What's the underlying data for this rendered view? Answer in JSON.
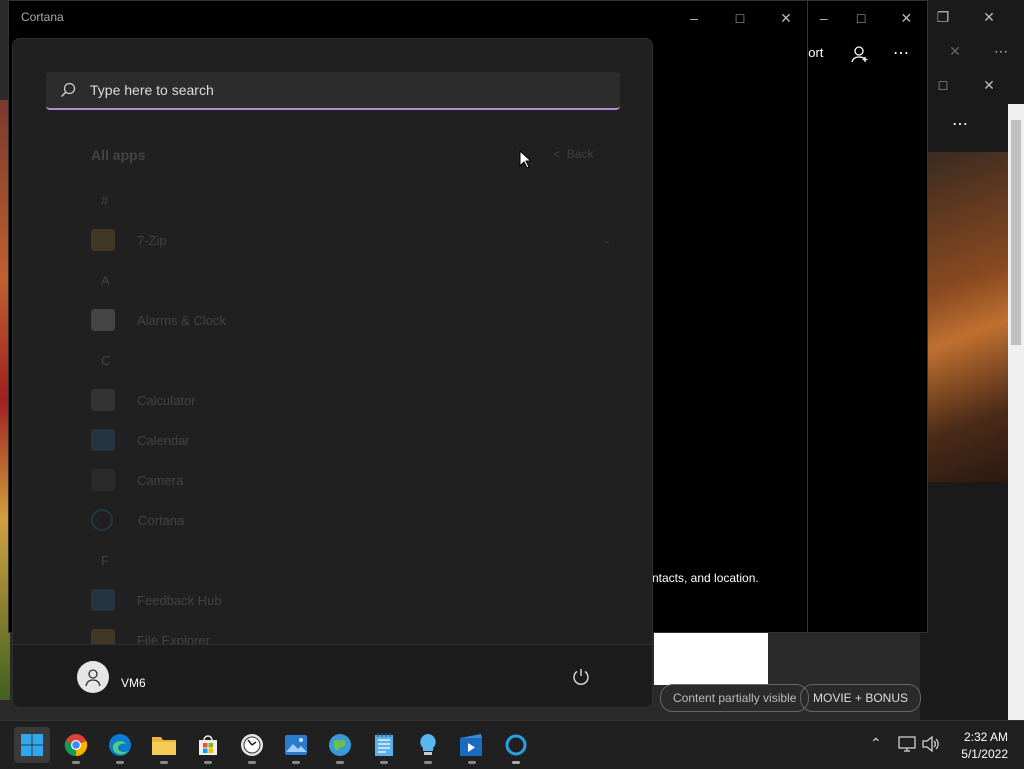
{
  "cortana_window": {
    "title": "Cortana"
  },
  "behind_window": {
    "menu_fragment": "port",
    "text_fragment": "ntacts, and location."
  },
  "media_app": {
    "chip_left": "Content partially visible",
    "chip_right": "MOVIE + BONUS"
  },
  "start_menu": {
    "search_placeholder": "Type here to search",
    "all_apps_label": "All apps",
    "back_label": "Back",
    "groups": [
      {
        "letter": "#",
        "apps": [
          {
            "name": "7-Zip",
            "icon": "folder-icon",
            "color": "#d4a53a"
          }
        ]
      },
      {
        "letter": "A",
        "apps": [
          {
            "name": "Alarms & Clock",
            "icon": "clock-icon",
            "color": "#e8e8e8"
          }
        ]
      },
      {
        "letter": "C",
        "apps": [
          {
            "name": "Calculator",
            "icon": "calculator-icon",
            "color": "#8a8a8a"
          },
          {
            "name": "Calendar",
            "icon": "calendar-icon",
            "color": "#3a8fd8"
          },
          {
            "name": "Camera",
            "icon": "camera-icon",
            "color": "#5a5a5a"
          },
          {
            "name": "Cortana",
            "icon": "cortana-icon",
            "color": "#2aa0e0"
          }
        ]
      },
      {
        "letter": "F",
        "apps": [
          {
            "name": "Feedback Hub",
            "icon": "feedback-icon",
            "color": "#3a8fd8"
          },
          {
            "name": "File Explorer",
            "icon": "folder-icon",
            "color": "#d4a53a"
          }
        ]
      }
    ],
    "user_name": "VM6"
  },
  "taskbar": {
    "apps": [
      "start-icon",
      "chrome-icon",
      "edge-icon",
      "file-explorer-icon",
      "store-icon",
      "clock-icon",
      "photos-icon",
      "maps-icon",
      "notepad-icon",
      "tips-icon",
      "movies-icon",
      "cortana-icon"
    ],
    "time": "2:32 AM",
    "date": "5/1/2022"
  }
}
